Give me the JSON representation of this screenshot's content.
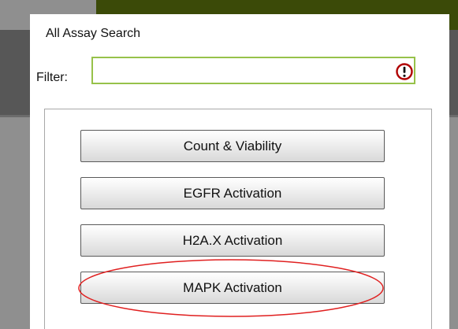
{
  "dialog": {
    "title": "All Assay Search",
    "filter_label": "Filter:",
    "filter_value": "",
    "filter_icon": "alert-icon"
  },
  "assays": [
    {
      "label": "Count & Viability"
    },
    {
      "label": "EGFR Activation"
    },
    {
      "label": "H2A.X Activation"
    },
    {
      "label": "MAPK Activation"
    }
  ],
  "colors": {
    "input_border": "#97c24a",
    "highlight": "#e02020",
    "alert": "#b00000"
  }
}
